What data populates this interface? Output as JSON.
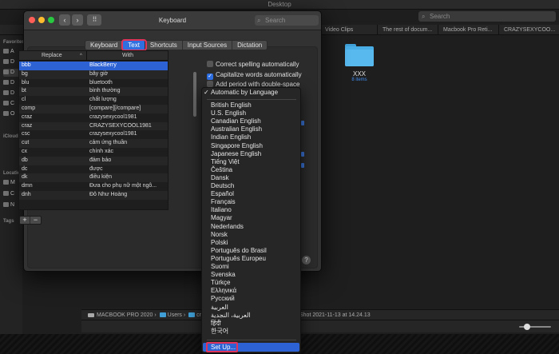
{
  "finder": {
    "title": "Desktop",
    "search_placeholder": "Search",
    "tabs": [
      "Video Clips",
      "The rest of docum...",
      "Macbook Pro Reti...",
      "CRAZYSEXYCOO..."
    ],
    "sidebar": {
      "favorites_head": "Favorites",
      "items": [
        "A",
        "D",
        "D",
        "D",
        "D",
        "C",
        "O"
      ],
      "icloud_head": "iCloud",
      "locations_head": "Locations",
      "locations": [
        "M",
        "C",
        "N"
      ],
      "tags_head": "Tags"
    },
    "folder": {
      "name": "XXX",
      "count": "8 items"
    },
    "pathbar": {
      "drive": "MACBOOK PRO 2020",
      "users": "Users",
      "user": "crazy",
      "file": "Shot 2021-11-13 at 14.24.13"
    }
  },
  "window": {
    "title": "Keyboard",
    "search_placeholder": "Search",
    "back_icon": "‹",
    "forward_icon": "›",
    "grid_icon": "⠿",
    "tabs": [
      {
        "label": "Keyboard",
        "active": false
      },
      {
        "label": "Text",
        "active": true
      },
      {
        "label": "Shortcuts",
        "active": false
      },
      {
        "label": "Input Sources",
        "active": false
      },
      {
        "label": "Dictation",
        "active": false
      }
    ]
  },
  "table": {
    "col_replace": "Replace",
    "col_with": "With",
    "rows": [
      {
        "replace": "bbb",
        "with": "BlackBerry",
        "selected": true
      },
      {
        "replace": "bg",
        "with": "bây giờ"
      },
      {
        "replace": "blu",
        "with": "bluetooth"
      },
      {
        "replace": "bt",
        "with": "bình thường"
      },
      {
        "replace": "cl",
        "with": "chất lượng"
      },
      {
        "replace": "comp",
        "with": "[compare][/compare]"
      },
      {
        "replace": "craz",
        "with": "crazysexycool1981"
      },
      {
        "replace": "craz",
        "with": "CRAZYSEXYCOOL1981"
      },
      {
        "replace": "csc",
        "with": "crazysexycool1981"
      },
      {
        "replace": "cut",
        "with": "cảm ứng thuần"
      },
      {
        "replace": "cx",
        "with": "chính xác"
      },
      {
        "replace": "db",
        "with": "đảm bảo"
      },
      {
        "replace": "dc",
        "with": "được"
      },
      {
        "replace": "dk",
        "with": "điều kiện"
      },
      {
        "replace": "dmn",
        "with": "Đưa cho phụ nữ một ngô..."
      },
      {
        "replace": "dnh",
        "with": "Đỗ Như Hoàng"
      }
    ],
    "add_label": "+",
    "remove_label": "−"
  },
  "options": {
    "correct_spelling": {
      "label": "Correct spelling automatically",
      "checked": false
    },
    "capitalize": {
      "label": "Capitalize words automatically",
      "checked": true
    },
    "add_period": {
      "label": "Add period with double-space",
      "checked": false
    }
  },
  "language_menu": {
    "selected": "Automatic by Language",
    "check_mark": "✓",
    "items": [
      "British English",
      "U.S. English",
      "Canadian English",
      "Australian English",
      "Indian English",
      "Singapore English",
      "Japanese English",
      "Tiếng Việt",
      "Čeština",
      "Dansk",
      "Deutsch",
      "Español",
      "Français",
      "Italiano",
      "Magyar",
      "Nederlands",
      "Norsk",
      "Polski",
      "Português do Brasil",
      "Português Europeu",
      "Suomi",
      "Svenska",
      "Türkçe",
      "Ελληνικά",
      "Русский",
      "العربية",
      "العربية، النجدية",
      "हिंदी",
      "한국어"
    ],
    "setup": "Set Up..."
  },
  "help_label": "?",
  "colors": {
    "accent": "#2d62d4",
    "highlight_outline": "#e0335b",
    "folder": "#4aaee6"
  }
}
